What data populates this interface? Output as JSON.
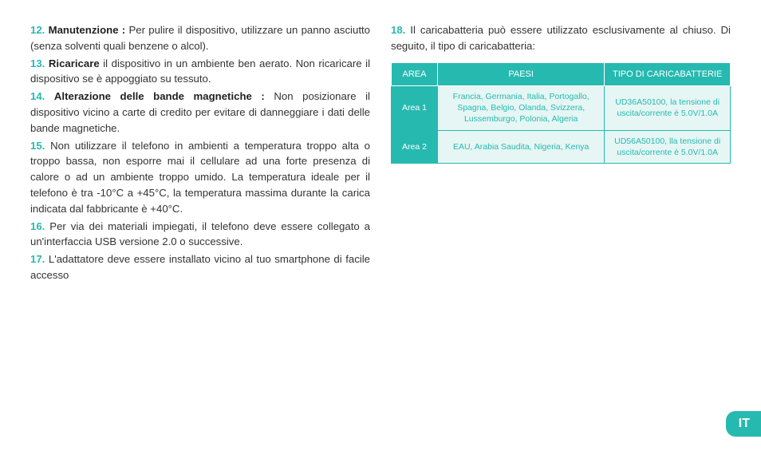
{
  "left": {
    "items": [
      {
        "num": "12.",
        "bold": "Manutenzione :",
        "text": " Per pulire il dispositivo, utilizzare un panno asciutto (senza solventi quali benzene o alcol)."
      },
      {
        "num": "13.",
        "bold": "Ricaricare",
        "text": " il dispositivo in un ambiente ben aerato. Non ricaricare il dispositivo se è appoggiato su tessuto."
      },
      {
        "num": "14.",
        "bold": "Alterazione delle bande magnetiche :",
        "text": " Non posizionare il dispositivo vicino a carte di credito per evitare di danneggiare i dati delle bande magnetiche."
      },
      {
        "num": "15.",
        "bold": "",
        "text": "Non utilizzare il telefono in ambienti a temperatura troppo alta o troppo bassa, non esporre mai il cellulare ad una forte presenza di calore o ad un ambiente troppo umido.  La temperatura ideale per il telefono è tra -10°C a +45°C, la temperatura massima durante la carica indicata dal fabbricante è  +40°C."
      },
      {
        "num": "16.",
        "bold": "",
        "text": " Per via dei materiali impiegati, il telefono deve essere collegato a un'interfaccia USB versione 2.0 o successive."
      },
      {
        "num": "17.",
        "bold": "",
        "text": " L'adattatore deve essere installato vicino al tuo smartphone di facile accesso"
      }
    ]
  },
  "right": {
    "intro": {
      "num": "18.",
      "text": " Il caricabatteria può essere utilizzato esclusivamente al chiuso. Di seguito, il tipo di caricabatteria:"
    },
    "table": {
      "headers": {
        "area": "AREA",
        "paesi": "PAESI",
        "tipo": "TIPO DI CARICABATTERIE"
      },
      "rows": [
        {
          "area": "Area 1",
          "paesi": "Francia, Germania, Italia, Portogallo, Spagna, Belgio, Olanda, Svizzera, Lussemburgo, Polonia, Algeria",
          "tipo": "UD36A50100, la tensione di uscita/corrente è 5.0V/1.0A"
        },
        {
          "area": "Area 2",
          "paesi": "EAU, Arabia Saudita, Nigeria, Kenya",
          "tipo": "UD56A50100, lla tensione di uscita/corrente è 5.0V/1.0A"
        }
      ]
    }
  },
  "lang": "IT"
}
